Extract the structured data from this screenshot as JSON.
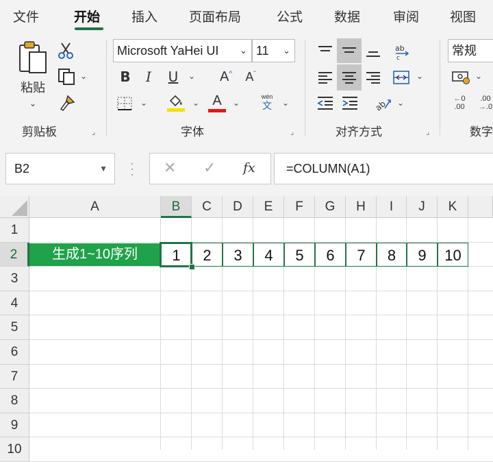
{
  "tabs": [
    {
      "label": "文件",
      "active": false
    },
    {
      "label": "开始",
      "active": true
    },
    {
      "label": "插入",
      "active": false
    },
    {
      "label": "页面布局",
      "active": false
    },
    {
      "label": "公式",
      "active": false
    },
    {
      "label": "数据",
      "active": false
    },
    {
      "label": "审阅",
      "active": false
    },
    {
      "label": "视图",
      "active": false
    }
  ],
  "clipboard": {
    "paste_label": "粘贴",
    "group_label": "剪贴板"
  },
  "font": {
    "family": "Microsoft YaHei UI",
    "size": "11",
    "bold_glyph": "B",
    "italic_glyph": "I",
    "underline_glyph": "U",
    "phonetic_top": "wén",
    "phonetic_bottom": "文",
    "group_label": "字体",
    "fill_color": "#f5e100",
    "font_color": "#e01818"
  },
  "alignment": {
    "group_label": "对齐方式"
  },
  "number": {
    "format": "常规",
    "group_label": "数字"
  },
  "formula_bar": {
    "name_box": "B2",
    "content": "=COLUMN(A1)",
    "fx_label": "fx"
  },
  "sheet": {
    "columns": [
      "A",
      "B",
      "C",
      "D",
      "E",
      "F",
      "G",
      "H",
      "I",
      "J",
      "K"
    ],
    "rows": [
      "1",
      "2",
      "3",
      "4",
      "5",
      "6",
      "7",
      "8",
      "9",
      "10"
    ],
    "selected_cell": "B2",
    "a2_text": "生成1~10序列",
    "row2_values": [
      "1",
      "2",
      "3",
      "4",
      "5",
      "6",
      "7",
      "8",
      "9",
      "10"
    ],
    "accent": "#217346",
    "label_fill": "#1fa24a"
  }
}
